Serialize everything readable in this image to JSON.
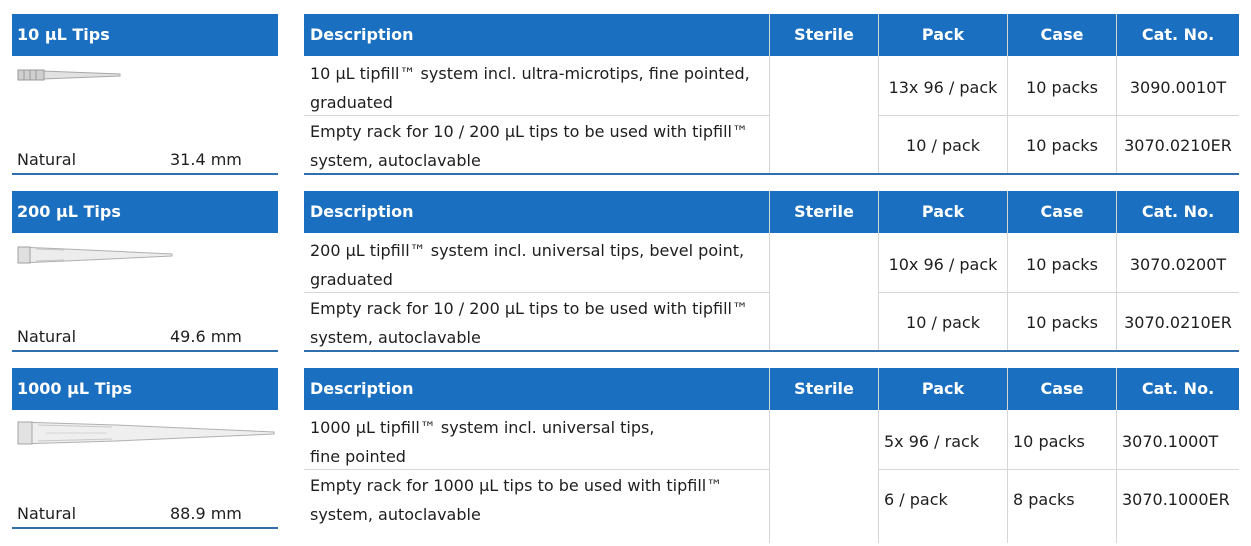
{
  "columns": {
    "description": "Description",
    "sterile": "Sterile",
    "pack": "Pack",
    "case": "Case",
    "cat": "Cat. No."
  },
  "sections": [
    {
      "title": "10 µL Tips",
      "material": "Natural",
      "length": "31.4 mm",
      "rows": [
        {
          "desc1": "10 µL tipfill™ system incl. ultra-microtips, fine pointed,",
          "desc2": "graduated",
          "pack": "13x 96 / pack",
          "case": "10 packs",
          "cat": "3090.0010T"
        },
        {
          "desc1": "Empty rack for 10 / 200 µL tips to be used with tipfill™",
          "desc2": "system, autoclavable",
          "pack": "10 / pack",
          "case": "10 packs",
          "cat": "3070.0210ER"
        }
      ]
    },
    {
      "title": "200 µL Tips",
      "material": "Natural",
      "length": "49.6 mm",
      "rows": [
        {
          "desc1": "200 µL tipfill™ system incl. universal tips, bevel point,",
          "desc2": "graduated",
          "pack": "10x 96 / pack",
          "case": "10 packs",
          "cat": "3070.0200T"
        },
        {
          "desc1": "Empty rack for  10 / 200 µL tips to be used with tipfill™",
          "desc2": "system, autoclavable",
          "pack": "10 / pack",
          "case": "10 packs",
          "cat": "3070.0210ER"
        }
      ]
    },
    {
      "title": "1000 µL Tips",
      "material": "Natural",
      "length": "88.9 mm",
      "rows": [
        {
          "desc1": "1000 µL tipfill™ system incl. universal tips,",
          "desc2": "fine pointed",
          "pack": "5x 96 / rack",
          "case": "10 packs",
          "cat": "3070.1000T"
        },
        {
          "desc1": "Empty rack for 1000 µL tips to be used with tipfill™",
          "desc2": "system, autoclavable",
          "pack": "6 / pack",
          "case": "8 packs",
          "cat": "3070.1000ER"
        }
      ]
    }
  ],
  "colors": {
    "header": "#1a6fc0",
    "rule": "#2f6fad"
  }
}
